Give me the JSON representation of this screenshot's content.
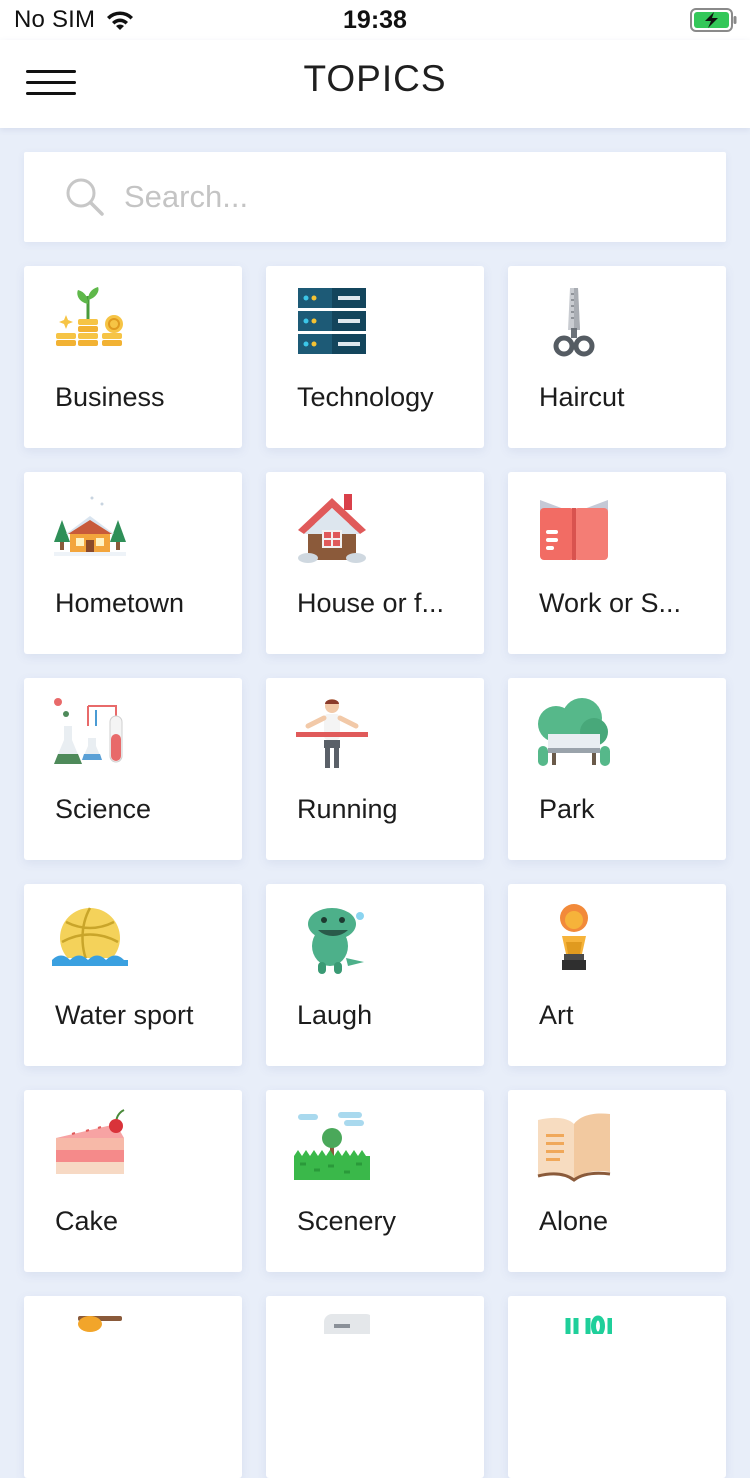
{
  "status_bar": {
    "carrier": "No SIM",
    "time": "19:38",
    "icons": [
      "wifi-icon",
      "battery-charging-icon"
    ],
    "battery_color": "#34c759"
  },
  "nav": {
    "title": "TOPICS",
    "menu_icon": "hamburger-menu-icon"
  },
  "search": {
    "placeholder": "Search...",
    "value": "",
    "icon": "search-icon"
  },
  "topics": [
    {
      "label": "Business",
      "icon": "coins-plant-icon"
    },
    {
      "label": "Technology",
      "icon": "server-rack-icon"
    },
    {
      "label": "Haircut",
      "icon": "scissors-icon"
    },
    {
      "label": "Hometown",
      "icon": "cabin-in-snow-icon"
    },
    {
      "label": "House or f...",
      "icon": "house-icon"
    },
    {
      "label": "Work or S...",
      "icon": "open-book-icon"
    },
    {
      "label": "Science",
      "icon": "lab-flasks-icon"
    },
    {
      "label": "Running",
      "icon": "runner-finish-line-icon"
    },
    {
      "label": "Park",
      "icon": "park-bench-icon"
    },
    {
      "label": "Water sport",
      "icon": "water-polo-ball-icon"
    },
    {
      "label": "Laugh",
      "icon": "laughing-dinosaur-icon"
    },
    {
      "label": "Art",
      "icon": "statue-bust-icon"
    },
    {
      "label": "Cake",
      "icon": "cake-slice-icon"
    },
    {
      "label": "Scenery",
      "icon": "meadow-tree-icon"
    },
    {
      "label": "Alone",
      "icon": "notebook-icon"
    },
    {
      "label": "",
      "icon": "honey-dipper-icon"
    },
    {
      "label": "",
      "icon": "gray-device-icon"
    },
    {
      "label": "",
      "icon": "green-digits-icon"
    }
  ],
  "colors": {
    "background": "#e8eef9",
    "card": "#ffffff",
    "text": "#1c1c1c",
    "placeholder": "#c4c4c4"
  }
}
